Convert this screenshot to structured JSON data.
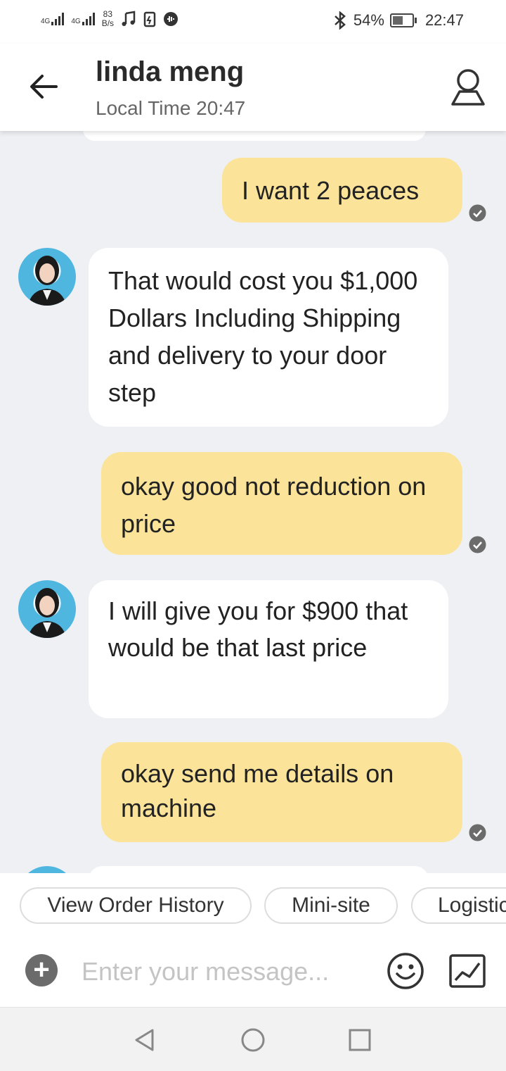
{
  "status_bar": {
    "net1": "4G",
    "net2": "4G",
    "speed_value": "83",
    "speed_unit": "B/s",
    "battery": "54%",
    "battery_level": 0.54,
    "time": "22:47"
  },
  "header": {
    "title": "linda meng",
    "subtitle": "Local Time 20:47"
  },
  "messages": [
    {
      "side": "sent",
      "text": "I want 2 peaces"
    },
    {
      "side": "received",
      "text": "That would cost you $1,000 Dollars Including Shipping and delivery to your door step"
    },
    {
      "side": "sent",
      "text": "okay  good not reduction on price"
    },
    {
      "side": "received",
      "text": "I will give you for $900 that would be that last price"
    },
    {
      "side": "sent",
      "text": "okay send me details on machine"
    }
  ],
  "quick_actions": [
    "View Order History",
    "Mini-site",
    "Logistic"
  ],
  "input": {
    "placeholder": "Enter your message..."
  },
  "colors": {
    "sent_bubble": "#fbe49a",
    "received_bubble": "#ffffff",
    "chat_background": "#eef0f4",
    "check": "#6b6b6b"
  },
  "icons": [
    "back-arrow-icon",
    "profile-icon",
    "read-check-icon",
    "plus-icon",
    "emoji-icon",
    "image-icon",
    "nav-back-icon",
    "nav-home-icon",
    "nav-recents-icon"
  ]
}
